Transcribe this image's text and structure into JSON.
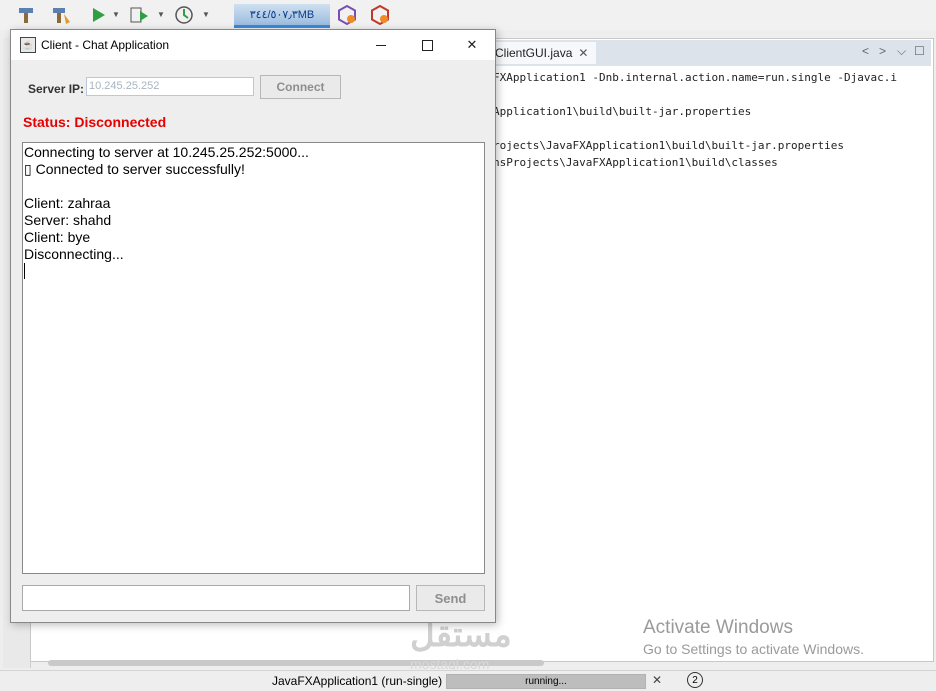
{
  "ide": {
    "memory_indicator": "٣٤٤/٥٠٧٫٣MB",
    "editor_tab": "ClientGUI.java",
    "output_lines": [
      "FXApplication1 -Dnb.internal.action.name=run.single -Djavac.i",
      "",
      "Application1\\build\\built-jar.properties",
      "",
      "rojects\\JavaFXApplication1\\build\\built-jar.properties",
      "nsProjects\\JavaFXApplication1\\build\\classes"
    ],
    "status_bar": {
      "run_label": "JavaFXApplication1 (run-single)",
      "progress_text": "running...",
      "notifications_count": "2"
    },
    "activate_title": "Activate Windows",
    "activate_subtitle": "Go to Settings to activate Windows.",
    "watermark": "مستقل",
    "watermark_sub": "mostaql.com"
  },
  "client_window": {
    "title": "Client - Chat Application",
    "server_ip_label": "Server IP:",
    "server_ip_value": "10.245.25.252",
    "connect_label": "Connect",
    "status_text": "Status: Disconnected",
    "chat_lines": [
      "Connecting to server at 10.245.25.252:5000...",
      "▯ Connected to server successfully!",
      "",
      "Client: zahraa",
      "Server: shahd",
      "Client: bye",
      "Disconnecting..."
    ],
    "message_value": "",
    "send_label": "Send"
  },
  "colors": {
    "status": "#e60000",
    "memory_chip": "#3a8ad8"
  }
}
